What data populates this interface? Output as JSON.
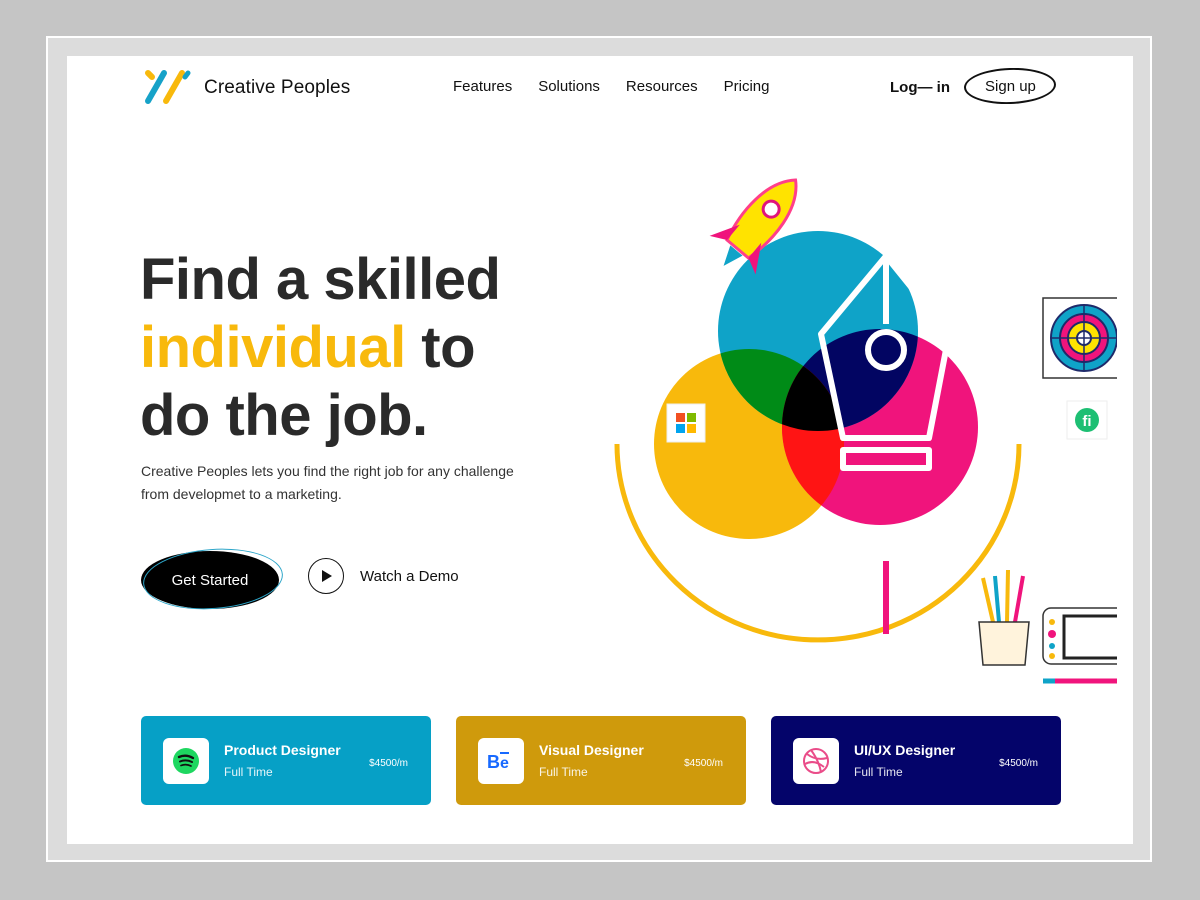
{
  "brand": {
    "name": "Creative Peoples"
  },
  "nav": {
    "items": [
      "Features",
      "Solutions",
      "Resources",
      "Pricing"
    ]
  },
  "auth": {
    "login": "Log— in",
    "signup": "Sign up"
  },
  "hero": {
    "headline_line1": "Find a skilled",
    "headline_accent": "individual",
    "headline_after_accent": " to",
    "headline_line3": "do the job.",
    "subtext": "Creative Peoples lets you find the right job for any challenge from developmet to a marketing.",
    "cta_primary": "Get Started",
    "cta_secondary": "Watch a Demo"
  },
  "jobs": [
    {
      "title": "Product Designer",
      "type": "Full Time",
      "salary": "$4500/m",
      "icon": "spotify-icon",
      "color": "#06a0c6"
    },
    {
      "title": "Visual Designer",
      "type": "Full Time",
      "salary": "$4500/m",
      "icon": "behance-icon",
      "color": "#cf9a0c"
    },
    {
      "title": "UI/UX Designer",
      "type": "Full Time",
      "salary": "$4500/m",
      "icon": "dribbble-icon",
      "color": "#04046a"
    }
  ],
  "colors": {
    "accent": "#f8b90c",
    "cyan": "#0fa3c8",
    "magenta": "#f0147c",
    "navy": "#04046a"
  }
}
